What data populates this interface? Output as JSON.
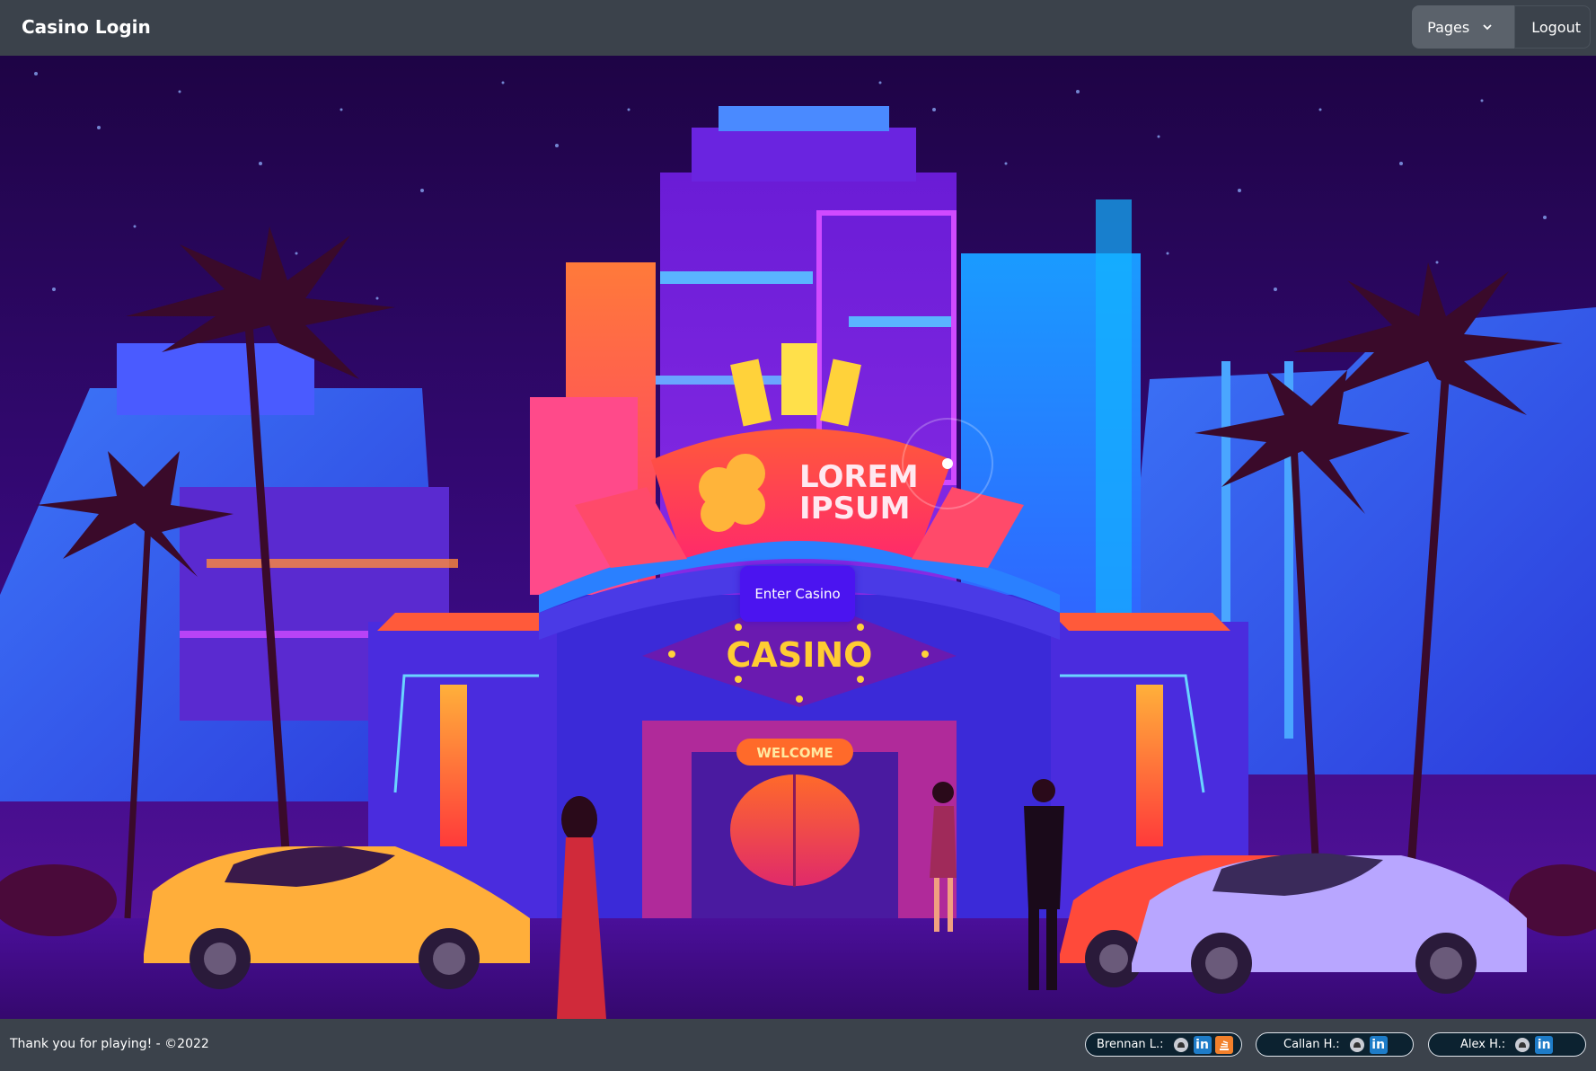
{
  "header": {
    "title": "Casino Login",
    "nav": {
      "pages_label": "Pages",
      "logout_label": "Logout"
    }
  },
  "hero": {
    "enter_button_label": "Enter Casino",
    "sign_text_line1": "LOREM",
    "sign_text_line2": "IPSUM",
    "casino_text": "CASINO",
    "welcome_text": "WELCOME"
  },
  "footer": {
    "text": "Thank you for playing! - ©2022",
    "credits": [
      {
        "name": "Brennan L.:",
        "icons": [
          "github-icon",
          "linkedin-icon",
          "stackoverflow-icon"
        ]
      },
      {
        "name": "Callan H.:",
        "icons": [
          "github-icon",
          "linkedin-icon"
        ]
      },
      {
        "name": "Alex H.:",
        "icons": [
          "github-icon",
          "linkedin-icon"
        ]
      }
    ],
    "linkedin_glyph": "in"
  },
  "colors": {
    "header_bg": "#3b424b",
    "enter_button": "#4b14f0",
    "sky": "#24064f",
    "sign": "#ff4a4a",
    "casino_text": "#ffcc33"
  }
}
